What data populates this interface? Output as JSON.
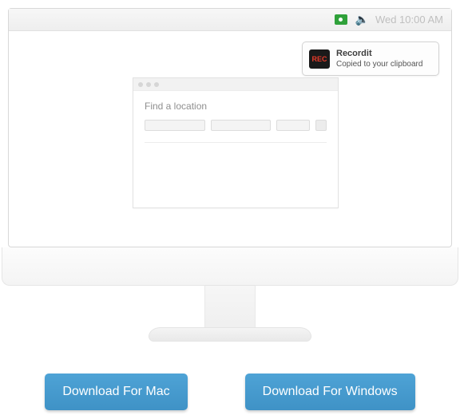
{
  "menubar": {
    "apple_glyph": "",
    "speaker_glyph": "🔈",
    "datetime": "Wed 10:00 AM"
  },
  "notification": {
    "badge_text": "REC",
    "title": "Recordit",
    "message": "Copied to your clipboard"
  },
  "app": {
    "heading": "Find a location"
  },
  "downloads": {
    "mac_label": "Download For Mac",
    "win_label": "Download For Windows"
  }
}
